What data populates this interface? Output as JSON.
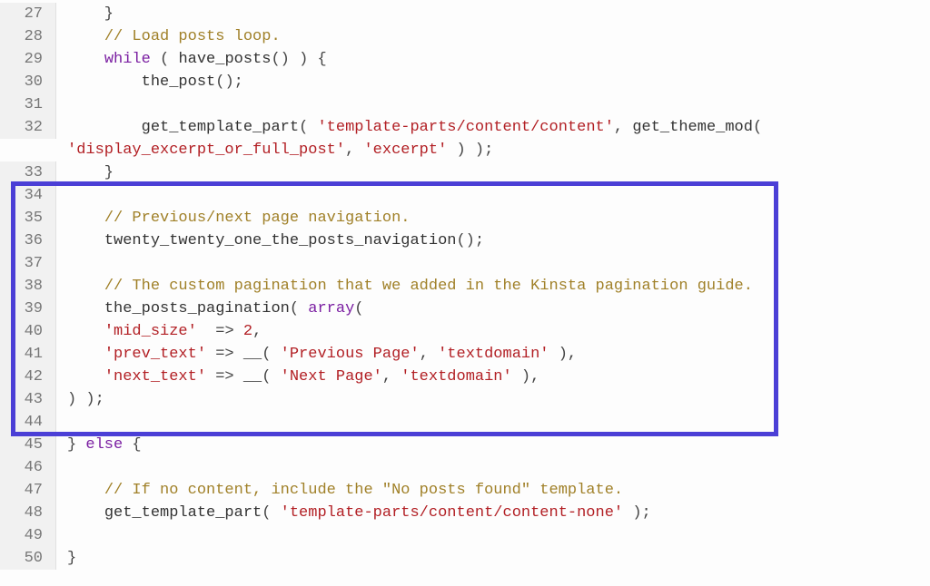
{
  "lines": [
    {
      "n": 27,
      "tokens": [
        {
          "t": "    }",
          "c": "pn"
        }
      ]
    },
    {
      "n": 28,
      "tokens": [
        {
          "t": "    ",
          "c": "pn"
        },
        {
          "t": "// Load posts loop.",
          "c": "cm"
        }
      ]
    },
    {
      "n": 29,
      "tokens": [
        {
          "t": "    ",
          "c": "pn"
        },
        {
          "t": "while",
          "c": "kw"
        },
        {
          "t": " ( ",
          "c": "pn"
        },
        {
          "t": "have_posts",
          "c": "fn"
        },
        {
          "t": "() ) {",
          "c": "pn"
        }
      ]
    },
    {
      "n": 30,
      "tokens": [
        {
          "t": "        ",
          "c": "pn"
        },
        {
          "t": "the_post",
          "c": "fn"
        },
        {
          "t": "();",
          "c": "pn"
        }
      ]
    },
    {
      "n": 31,
      "tokens": []
    },
    {
      "n": 32,
      "tokens": [
        {
          "t": "        ",
          "c": "pn"
        },
        {
          "t": "get_template_part",
          "c": "fn"
        },
        {
          "t": "( ",
          "c": "pn"
        },
        {
          "t": "'template-parts/content/content'",
          "c": "str"
        },
        {
          "t": ", ",
          "c": "pn"
        },
        {
          "t": "get_theme_mod",
          "c": "fn"
        },
        {
          "t": "( ",
          "c": "pn"
        }
      ]
    },
    {
      "n": 32,
      "cont": true,
      "tokens": [
        {
          "t": "'display_excerpt_or_full_post'",
          "c": "str"
        },
        {
          "t": ", ",
          "c": "pn"
        },
        {
          "t": "'excerpt'",
          "c": "str"
        },
        {
          "t": " ) );",
          "c": "pn"
        }
      ]
    },
    {
      "n": 33,
      "tokens": [
        {
          "t": "    }",
          "c": "pn"
        }
      ]
    },
    {
      "n": 34,
      "tokens": []
    },
    {
      "n": 35,
      "tokens": [
        {
          "t": "    ",
          "c": "pn"
        },
        {
          "t": "// Previous/next page navigation.",
          "c": "cm"
        }
      ]
    },
    {
      "n": 36,
      "tokens": [
        {
          "t": "    ",
          "c": "pn"
        },
        {
          "t": "twenty_twenty_one_the_posts_navigation",
          "c": "fn"
        },
        {
          "t": "();",
          "c": "pn"
        }
      ]
    },
    {
      "n": 37,
      "tokens": []
    },
    {
      "n": 38,
      "tokens": [
        {
          "t": "    ",
          "c": "pn"
        },
        {
          "t": "// The custom pagination that we added in the Kinsta pagination guide.",
          "c": "cm"
        }
      ]
    },
    {
      "n": 39,
      "tokens": [
        {
          "t": "    ",
          "c": "pn"
        },
        {
          "t": "the_posts_pagination",
          "c": "fn"
        },
        {
          "t": "( ",
          "c": "pn"
        },
        {
          "t": "array",
          "c": "kw"
        },
        {
          "t": "(",
          "c": "pn"
        }
      ]
    },
    {
      "n": 40,
      "tokens": [
        {
          "t": "    ",
          "c": "pn"
        },
        {
          "t": "'mid_size'",
          "c": "str"
        },
        {
          "t": "  => ",
          "c": "pn"
        },
        {
          "t": "2",
          "c": "num"
        },
        {
          "t": ",",
          "c": "pn"
        }
      ]
    },
    {
      "n": 41,
      "tokens": [
        {
          "t": "    ",
          "c": "pn"
        },
        {
          "t": "'prev_text'",
          "c": "str"
        },
        {
          "t": " => ",
          "c": "pn"
        },
        {
          "t": "__",
          "c": "fn"
        },
        {
          "t": "( ",
          "c": "pn"
        },
        {
          "t": "'Previous Page'",
          "c": "str"
        },
        {
          "t": ", ",
          "c": "pn"
        },
        {
          "t": "'textdomain'",
          "c": "str"
        },
        {
          "t": " ),",
          "c": "pn"
        }
      ]
    },
    {
      "n": 42,
      "tokens": [
        {
          "t": "    ",
          "c": "pn"
        },
        {
          "t": "'next_text'",
          "c": "str"
        },
        {
          "t": " => ",
          "c": "pn"
        },
        {
          "t": "__",
          "c": "fn"
        },
        {
          "t": "( ",
          "c": "pn"
        },
        {
          "t": "'Next Page'",
          "c": "str"
        },
        {
          "t": ", ",
          "c": "pn"
        },
        {
          "t": "'textdomain'",
          "c": "str"
        },
        {
          "t": " ),",
          "c": "pn"
        }
      ]
    },
    {
      "n": 43,
      "tokens": [
        {
          "t": ") );",
          "c": "pn"
        }
      ]
    },
    {
      "n": 44,
      "tokens": []
    },
    {
      "n": 45,
      "tokens": [
        {
          "t": "} ",
          "c": "pn"
        },
        {
          "t": "else",
          "c": "kw"
        },
        {
          "t": " {",
          "c": "pn"
        }
      ]
    },
    {
      "n": 46,
      "tokens": []
    },
    {
      "n": 47,
      "tokens": [
        {
          "t": "    ",
          "c": "pn"
        },
        {
          "t": "// If no content, include the \"No posts found\" template.",
          "c": "cm"
        }
      ]
    },
    {
      "n": 48,
      "tokens": [
        {
          "t": "    ",
          "c": "pn"
        },
        {
          "t": "get_template_part",
          "c": "fn"
        },
        {
          "t": "( ",
          "c": "pn"
        },
        {
          "t": "'template-parts/content/content-none'",
          "c": "str"
        },
        {
          "t": " );",
          "c": "pn"
        }
      ]
    },
    {
      "n": 49,
      "tokens": []
    },
    {
      "n": 50,
      "tokens": [
        {
          "t": "}",
          "c": "pn"
        }
      ]
    }
  ],
  "highlight": {
    "startLine": 34,
    "endLine": 44
  }
}
